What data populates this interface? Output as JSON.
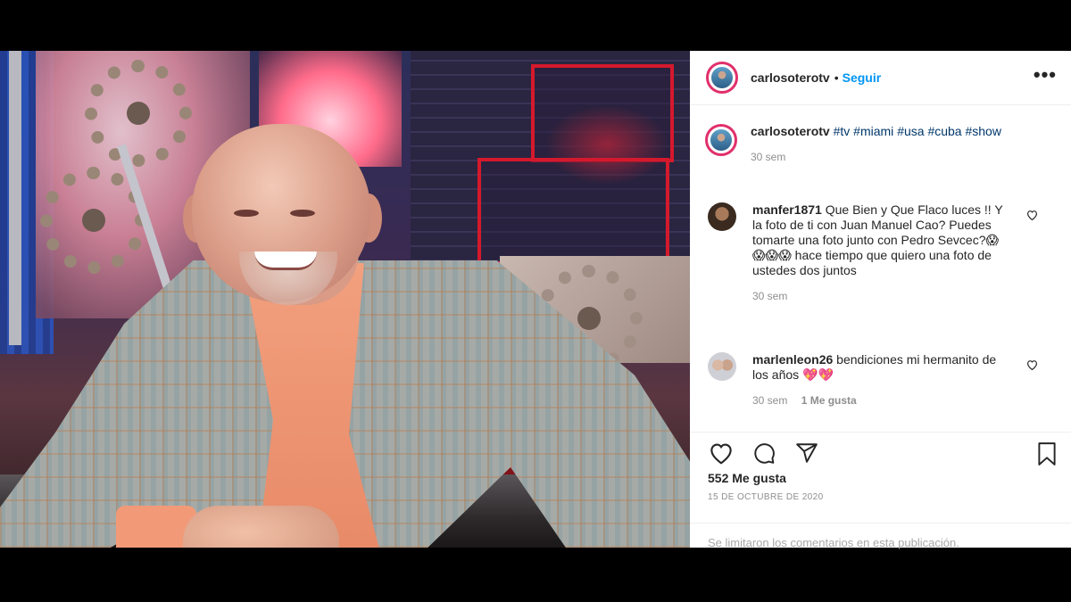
{
  "post": {
    "username": "carlosoterotv",
    "follow_label": "Seguir",
    "more_label": "•••"
  },
  "caption": {
    "username": "carlosoterotv",
    "hashtags": [
      "#tv",
      "#miami",
      "#usa",
      "#cuba",
      "#show"
    ],
    "time": "30 sem"
  },
  "comments": [
    {
      "username": "manfer1871",
      "text": "Que Bien y Que Flaco luces !! Y la foto de ti con Juan Manuel Cao? Puedes tomarte una foto junto con Pedro Sevcec?😱😱😱😱 hace tiempo que quiero una foto de ustedes dos juntos",
      "time": "30 sem",
      "likes": ""
    },
    {
      "username": "marlenleon26",
      "text": "bendiciones mi hermanito de los años 💖💖",
      "time": "30 sem",
      "likes": "1 Me gusta"
    }
  ],
  "footer": {
    "likes": "552 Me gusta",
    "date": "15 DE OCTUBRE DE 2020",
    "limited": "Se limitaron los comentarios en esta publicación."
  },
  "icons": {
    "like": "heart-icon",
    "comment": "comment-icon",
    "share": "share-icon",
    "save": "bookmark-icon"
  },
  "colors": {
    "link_blue": "#0095f6",
    "hashtag": "#00376b",
    "muted": "#8e8e8e",
    "story_ring": "#e1306c"
  }
}
